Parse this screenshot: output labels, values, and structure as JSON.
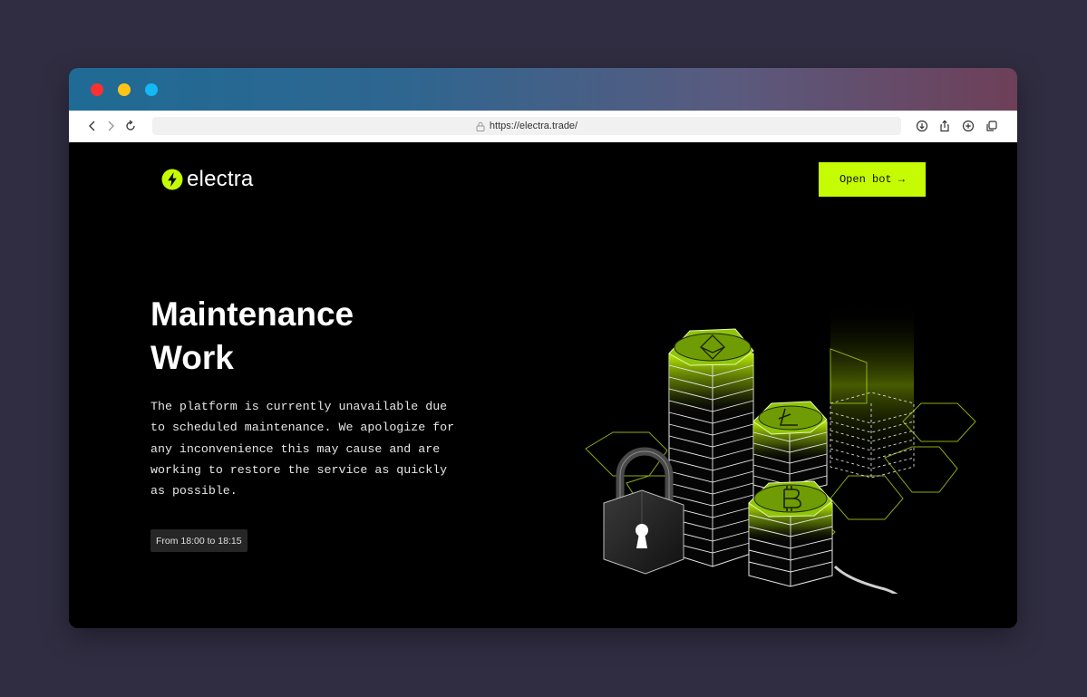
{
  "browser": {
    "url": "https://electra.trade/",
    "icons": [
      "back-icon",
      "forward-icon",
      "reload-icon",
      "lock-icon",
      "download-icon",
      "share-icon",
      "new-tab-icon",
      "tabs-icon"
    ]
  },
  "header": {
    "logo_text": "electra",
    "cta_label": "Open bot →"
  },
  "main": {
    "title_line1": "Maintenance",
    "title_line2": "Work",
    "description": "The platform is currently unavailable due to scheduled maintenance. We apologize for any inconvenience this may cause and are working to restore the service as quickly as possible.",
    "time_badge": "From 18:00 to 18:15"
  },
  "colors": {
    "accent": "#c6fc03",
    "page_bg": "#000000",
    "outer_bg": "#302d42"
  }
}
